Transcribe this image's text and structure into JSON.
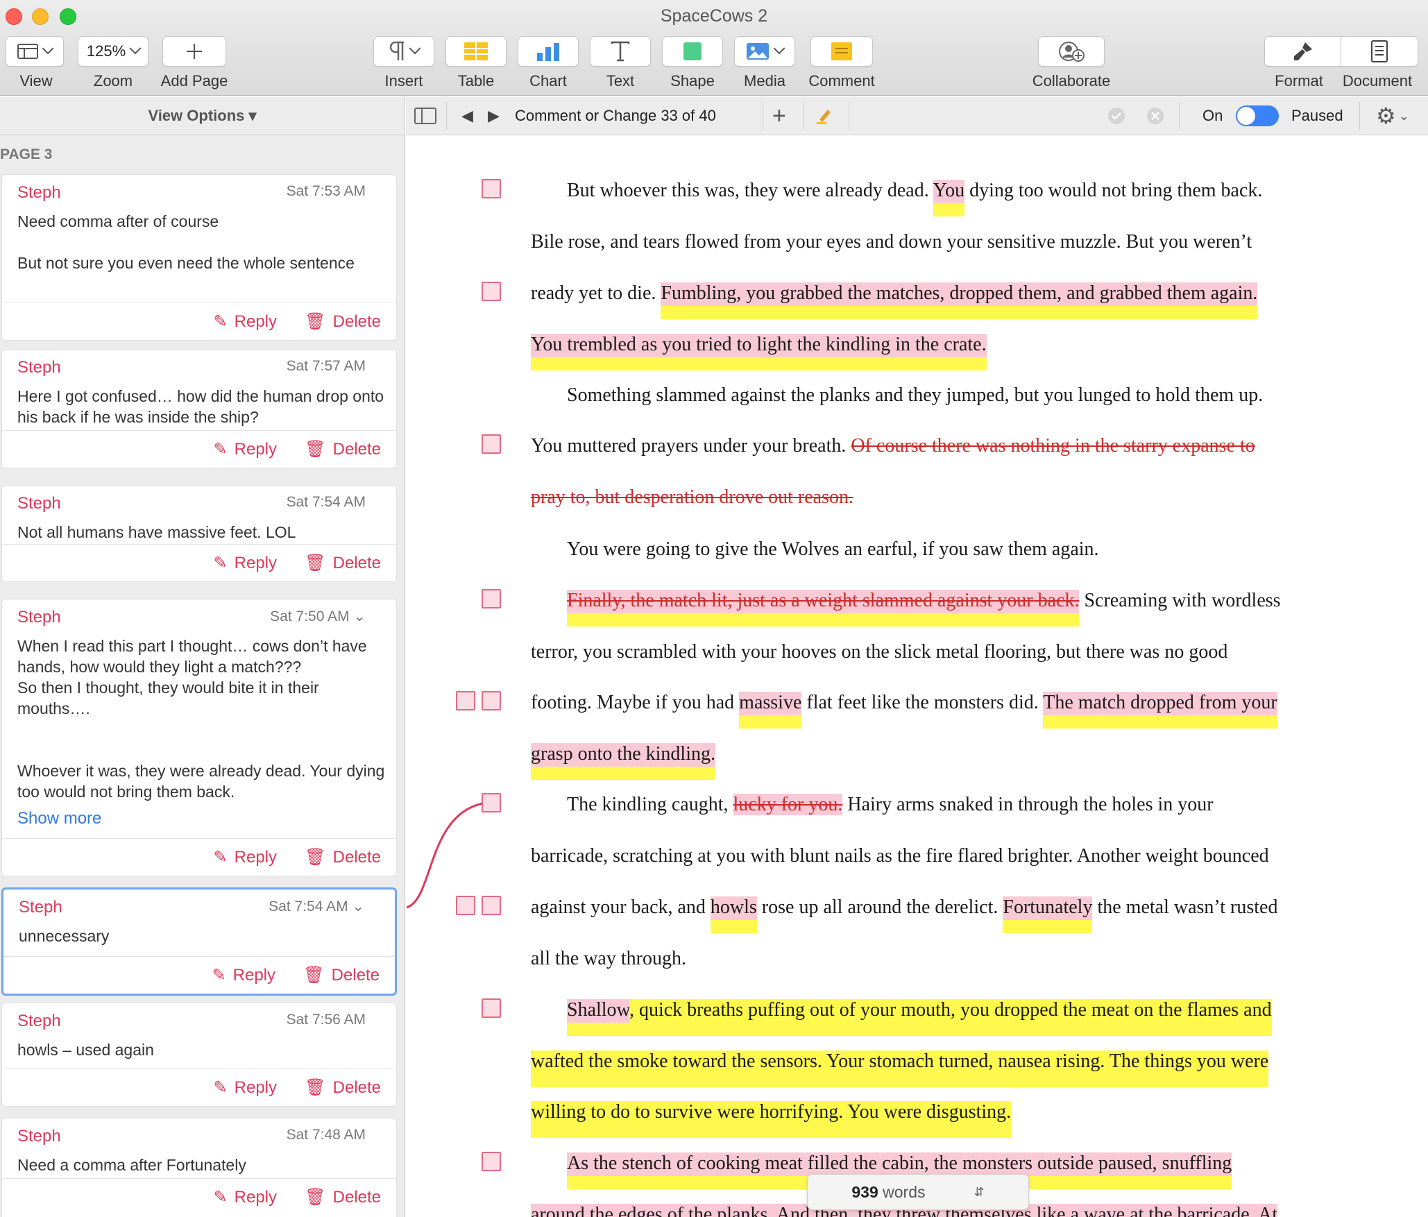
{
  "window": {
    "title": "SpaceCows 2"
  },
  "toolbar": {
    "view": "View",
    "zoom": "Zoom",
    "zoom_value": "125%",
    "add_page": "Add Page",
    "insert": "Insert",
    "table": "Table",
    "chart": "Chart",
    "text": "Text",
    "shape": "Shape",
    "media": "Media",
    "comment": "Comment",
    "collaborate": "Collaborate",
    "format": "Format",
    "document": "Document"
  },
  "sidebar": {
    "view_options": "View Options ▾",
    "page_label": "PAGE 3",
    "reply_label": "Reply",
    "delete_label": "Delete",
    "show_more": "Show more",
    "comments": [
      {
        "author": "Steph",
        "time": "Sat 7:53 AM",
        "body": "Need comma after of course\n\nBut not sure you even need the whole sentence"
      },
      {
        "author": "Steph",
        "time": "Sat 7:57 AM",
        "body": "Here I got confused… how did the human drop onto his back if he was inside the ship?"
      },
      {
        "author": "Steph",
        "time": "Sat 7:54 AM",
        "body": "Not all humans have massive feet. LOL"
      },
      {
        "author": "Steph",
        "time": "Sat 7:50 AM",
        "body": "When I read this part I thought… cows don’t have hands, how would they light a match???\nSo then I thought, they would bite it in their mouths….\n\n\nWhoever it was, they were already dead. Your dying too would not bring them back."
      },
      {
        "author": "Steph",
        "time": "Sat 7:54 AM",
        "body": "unnecessary"
      },
      {
        "author": "Steph",
        "time": "Sat 7:56 AM",
        "body": "howls – used again"
      },
      {
        "author": "Steph",
        "time": "Sat 7:48 AM",
        "body": "Need a comma after Fortunately"
      }
    ]
  },
  "tracking": {
    "status": "Comment or Change 33 of 40",
    "toggle_on": "On",
    "paused": "Paused"
  },
  "document": {
    "lines": [
      [
        "But whoever this was, they were already dead. ",
        "You",
        " dying too would not bring them back."
      ],
      [
        "Bile rose, and tears flowed from your eyes and down your sensitive muzzle. But you weren’t"
      ],
      [
        "ready yet to die. ",
        "Fumbling, you grabbed the matches, dropped them, and grabbed them again."
      ],
      [
        "You trembled as you tried to light the kindling in the crate."
      ],
      [
        "Something slammed against the planks and they jumped, but you lunged to hold them up."
      ],
      [
        "You muttered prayers under your breath. ",
        "Of course there was nothing in the starry expanse to"
      ],
      [
        "pray to, but desperation drove out reason. "
      ],
      [
        "You were going to give the Wolves an earful, if you saw them again."
      ],
      [
        "Finally, the match lit, just as a weight slammed against your back.",
        " Screaming with wordless"
      ],
      [
        "terror, you scrambled with your hooves on the slick metal flooring, but there was no good"
      ],
      [
        "footing. Maybe if you had ",
        "massive",
        " flat feet like the monsters did. ",
        "The match dropped from your"
      ],
      [
        "grasp onto the kindling. "
      ],
      [
        "The kindling caught, ",
        "lucky for you.",
        " Hairy arms snaked in through the holes in your"
      ],
      [
        "barricade, scratching at you with blunt nails as the fire flared brighter. Another weight bounced"
      ],
      [
        "against your back, and ",
        "howls",
        " rose up all around the derelict. ",
        "Fortunately",
        " the metal wasn’t rusted"
      ],
      [
        "all the way through."
      ],
      [
        "Shallow",
        ", quick breaths puffing out of your mouth, you dropped the meat on the flames and"
      ],
      [
        "wafted the smoke toward the sensors. Your stomach turned, nausea rising. The things you were"
      ],
      [
        "willing to do to survive were horrifying. You were disgusting."
      ],
      [
        "As the stench of cooking meat filled the cabin, the monsters outside paused, snuffling"
      ],
      [
        "around the edges of the planks. And then, they threw themselves like a wave at the barricade. At"
      ]
    ],
    "word_count": "939",
    "word_label": " words"
  },
  "colors": {
    "accent": "#e0385a",
    "highlight": "#fff94d",
    "insertion": "#fac8d6",
    "deletion": "#cc2b2b",
    "selection": "#70a6ea"
  }
}
